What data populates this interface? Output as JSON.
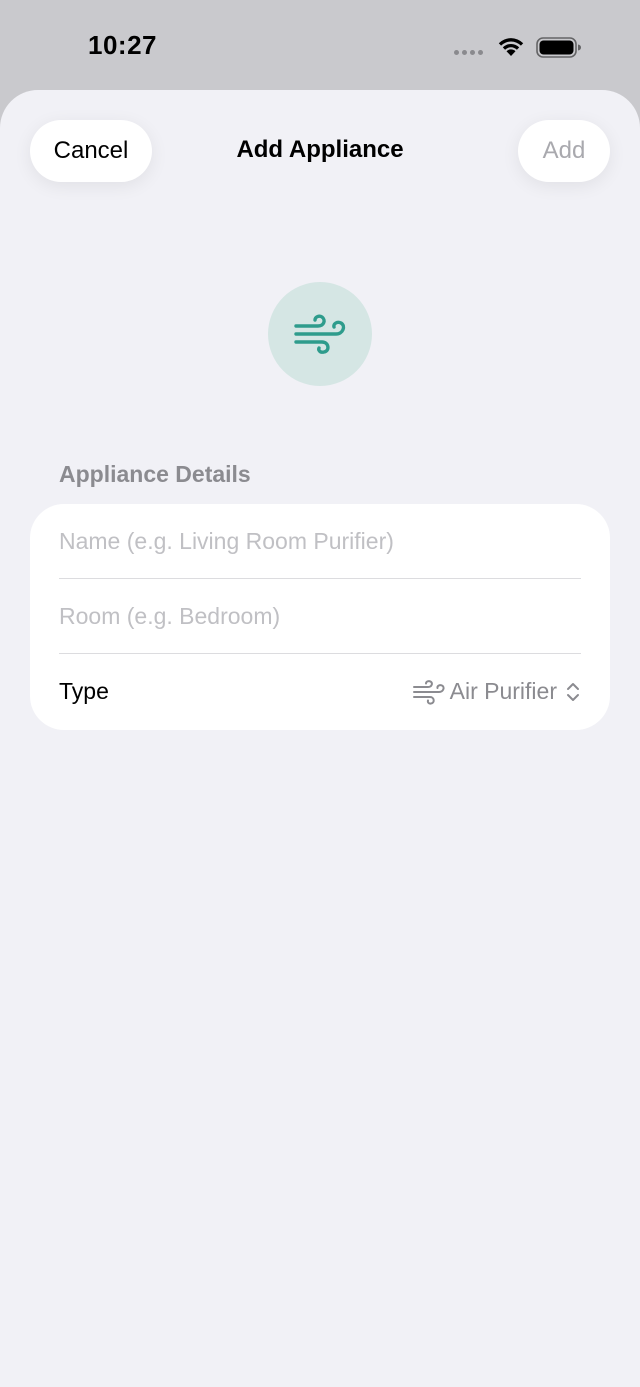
{
  "status_bar": {
    "time": "10:27"
  },
  "nav": {
    "cancel_label": "Cancel",
    "title": "Add Appliance",
    "add_label": "Add"
  },
  "hero": {
    "icon": "wind-icon",
    "color": "#2e9c8c"
  },
  "form": {
    "section_title": "Appliance Details",
    "name_field": {
      "value": "",
      "placeholder": "Name (e.g. Living Room Purifier)"
    },
    "room_field": {
      "value": "",
      "placeholder": "Room (e.g. Bedroom)"
    },
    "type_row": {
      "label": "Type",
      "value": "Air Purifier",
      "icon": "wind-icon"
    }
  },
  "colors": {
    "accent": "#2e9c8c",
    "hero_bg": "#d5e6e4",
    "sheet_bg": "#f1f1f6",
    "secondary_text": "#8b8b90",
    "disabled_text": "#a9a9ae"
  }
}
